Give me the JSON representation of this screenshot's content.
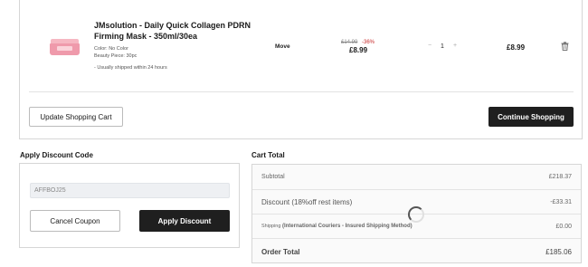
{
  "cart_item": {
    "title": "JMsolution - Daily Quick Collagen PDRN Firming Mask - 350ml/30ea",
    "option_color": "Color: No Color",
    "option_beauty": "Beauty Piece: 30pc",
    "shipping_note": "- Usually shipped within 24 hours",
    "move_label": "Move",
    "old_price": "£14.99",
    "discount_percent": "-36%",
    "price": "£8.99",
    "qty_minus": "−",
    "qty": "1",
    "qty_plus": "+",
    "line_total": "£8.99",
    "delete_icon": "trash-icon"
  },
  "cart_actions": {
    "update_label": "Update Shopping Cart",
    "continue_label": "Continue Shopping"
  },
  "discount": {
    "heading": "Apply Discount Code",
    "code_value": "AFFBOJ25",
    "cancel_label": "Cancel Coupon",
    "apply_label": "Apply Discount"
  },
  "totals": {
    "heading": "Cart Total",
    "subtotal_label": "Subtotal",
    "subtotal_value": "£218.37",
    "discount_label": "Discount (18%off rest items)",
    "discount_value": "-£33.31",
    "shipping_label": "Shipping",
    "shipping_method": "(International Couriers - Insured Shipping Method)",
    "shipping_value": "£0.00",
    "order_total_label": "Order Total",
    "order_total_value": "£185.06"
  },
  "colors": {
    "primary_button": "#1f1f1f",
    "discount_red": "#c62828",
    "product_pink": "#ef9aab"
  }
}
